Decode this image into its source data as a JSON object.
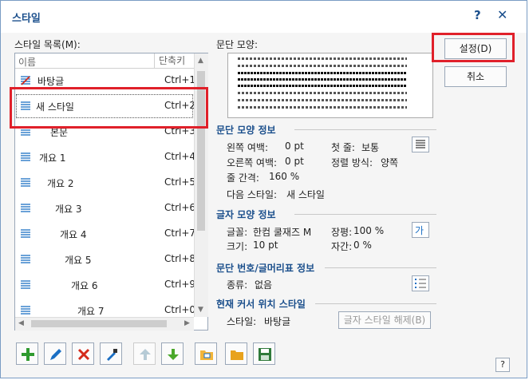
{
  "window": {
    "title": "스타일",
    "help": "?",
    "close": "✕"
  },
  "list": {
    "label": "스타일 목록(M):",
    "col_name": "이름",
    "col_shortcut": "단축키",
    "items": [
      {
        "name": "바탕글",
        "shortcut": "Ctrl+1"
      },
      {
        "name": "새 스타일",
        "shortcut": "Ctrl+2"
      },
      {
        "name": "본문",
        "shortcut": "Ctrl+3"
      },
      {
        "name": "개요 1",
        "shortcut": "Ctrl+4"
      },
      {
        "name": "개요 2",
        "shortcut": "Ctrl+5"
      },
      {
        "name": "개요 3",
        "shortcut": "Ctrl+6"
      },
      {
        "name": "개요 4",
        "shortcut": "Ctrl+7"
      },
      {
        "name": "개요 5",
        "shortcut": "Ctrl+8"
      },
      {
        "name": "개요 6",
        "shortcut": "Ctrl+9"
      },
      {
        "name": "개요 7",
        "shortcut": "Ctrl+0"
      }
    ]
  },
  "preview": {
    "label": "문단 모양:"
  },
  "para_info": {
    "heading": "문단 모양 정보",
    "left_margin_label": "왼쪽 여백:",
    "left_margin": "0 pt",
    "first_line_label": "첫 줄:",
    "first_line": "보통",
    "right_margin_label": "오른쪽 여백:",
    "right_margin": "0 pt",
    "align_label": "정렬 방식:",
    "align": "양쪽",
    "line_spacing_label": "줄 간격:",
    "line_spacing": "160 %",
    "next_style_label": "다음 스타일:",
    "next_style": "새 스타일"
  },
  "char_info": {
    "heading": "글자 모양 정보",
    "font_label": "글꼴:",
    "font": "한컴 쿨재즈 M",
    "width_label": "장평:",
    "width": "100 %",
    "size_label": "크기:",
    "size": "10 pt",
    "spacing_label": "자간:",
    "spacing": "0 %"
  },
  "numbering_info": {
    "heading": "문단 번호/글머리표 정보",
    "type_label": "종류:",
    "type": "없음"
  },
  "cursor_info": {
    "heading": "현재 커서 위치 스타일",
    "style_label": "스타일:",
    "style": "바탕글",
    "release_button": "글자 스타일 해제(B)"
  },
  "buttons": {
    "settings": "설정(D)",
    "cancel": "취소"
  },
  "footer_help": "?",
  "colors": {
    "accent": "#1b4f8c",
    "highlight": "#e0202a"
  }
}
